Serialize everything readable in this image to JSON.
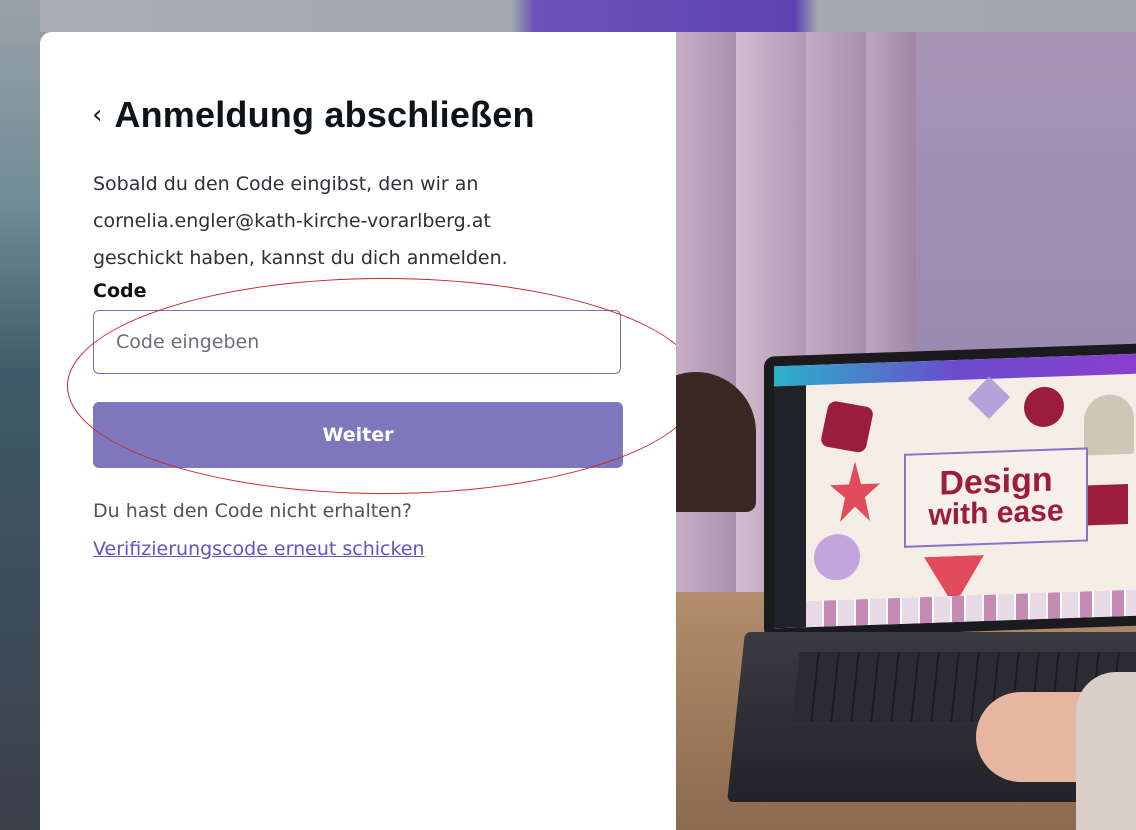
{
  "modal": {
    "title": "Anmeldung abschließen",
    "back_icon": "chevron-left-icon",
    "description_lines": [
      "Sobald du den Code eingibst, den wir an",
      "cornelia.engler@kath-kirche-vorarlberg.at",
      "geschickt haben, kannst du dich anmelden."
    ],
    "code_label": "Code",
    "code_placeholder": "Code eingeben",
    "code_value": "",
    "submit_label": "Weiter",
    "not_received_text": "Du hast den Code nicht erhalten?",
    "resend_link": "Verifizierungscode erneut schicken"
  },
  "illustration": {
    "screen_headline_line1": "Design",
    "screen_headline_line2": "with ease"
  },
  "colors": {
    "button": "#7f77bd",
    "link": "#6353c4",
    "input_border": "#7b6fb9",
    "annotation": "#c8252b",
    "headline": "#9b1d3b"
  }
}
